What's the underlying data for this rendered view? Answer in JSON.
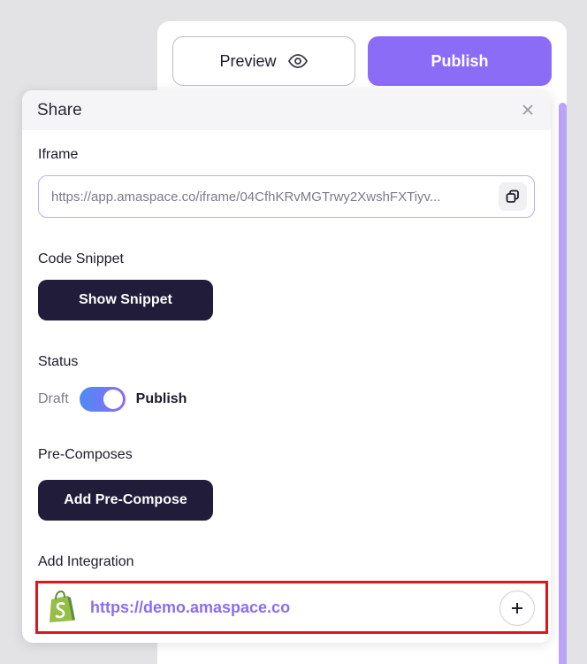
{
  "toolbar": {
    "preview_label": "Preview",
    "publish_label": "Publish"
  },
  "share": {
    "title": "Share",
    "iframe": {
      "label": "Iframe",
      "value": "https://app.amaspace.co/iframe/04CfhKRvMGTrwy2XwshFXTiyv..."
    },
    "code_snippet": {
      "label": "Code Snippet",
      "button_label": "Show Snippet"
    },
    "status": {
      "label": "Status",
      "off_label": "Draft",
      "on_label": "Publish",
      "enabled": true
    },
    "pre_composes": {
      "label": "Pre-Composes",
      "button_label": "Add Pre-Compose"
    },
    "integration": {
      "label": "Add Integration",
      "link": "https://demo.amaspace.co",
      "icon": "shopify-icon"
    }
  },
  "colors": {
    "accent": "#8b6cf7",
    "dark_button": "#201c3a",
    "highlight_border": "#e2141b",
    "shopify_green": "#95bf47"
  }
}
